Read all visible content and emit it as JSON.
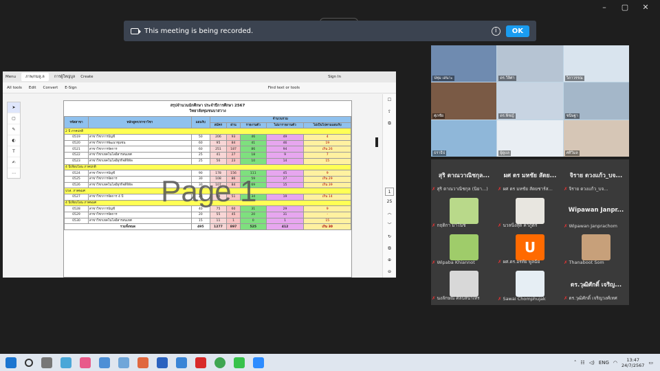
{
  "window": {
    "min": "–",
    "max": "▢",
    "close": "✕"
  },
  "recbar": {
    "message": "This meeting is being recorded.",
    "ok": "OK",
    "info": "i"
  },
  "pdf": {
    "tabs": [
      "Menu",
      "ภาพ/กมลู.ล",
      "การผู้ใหญ่บูล",
      "Create",
      "Sign In"
    ],
    "menu": [
      "All tools",
      "Edit",
      "Convert",
      "E-Sign"
    ],
    "find": "Find text or tools",
    "title": "สรุปจำนวนนักศึกษา ประจำปีการศึกษา 2567",
    "subtitle": "วิทยาลัยชุมชนบาสวาง",
    "watermark": "Page 1",
    "headers": [
      "รหัสสาขา",
      "หลักสูตร/สาขาวิชา",
      "แผนรับ",
      "สมัคร",
      "ผ่าน",
      "รายงานตัว",
      "ไม่มารายงานตัว",
      "ไม่เป็นไปตามแผนรับ"
    ],
    "group_header": "จำนวนรวม",
    "page_num": "1",
    "page_total": "25",
    "rows": [
      {
        "sec": "2 ปี ภาคปกติ"
      },
      {
        "c": "0519",
        "n": "สาขาวิชาการบัญชี",
        "p": "50",
        "a": "206",
        "b": "93",
        "r": "46",
        "x": "49",
        "d": "4"
      },
      {
        "c": "0520",
        "n": "สาขาวิชาการพัฒนาชุมชน",
        "p": "60",
        "a": "95",
        "b": "84",
        "r": "41",
        "x": "46",
        "d": "19"
      },
      {
        "c": "0521",
        "n": "สาขาวิชาการจัดการ",
        "p": "60",
        "a": "251",
        "b": "187",
        "r": "86",
        "x": "94",
        "d": "เกิน 26"
      },
      {
        "c": "0522",
        "n": "สาขาวิชาเทคโนโลยีสารสนเทศ",
        "p": "25",
        "a": "41",
        "b": "27",
        "r": "18",
        "x": "9",
        "d": "7"
      },
      {
        "c": "0523",
        "n": "สาขาวิชาเทคโนโลยีธุรกิจดิจิทัล",
        "p": "25",
        "a": "56",
        "b": "23",
        "r": "10",
        "x": "14",
        "d": "15"
      },
      {
        "sec": "4 ปีเทียบโอน ภาคปกติ"
      },
      {
        "c": "0524",
        "n": "สาขาวิชาการบัญชี",
        "p": "90",
        "a": "178",
        "b": "156",
        "r": "111",
        "x": "45",
        "d": "9"
      },
      {
        "c": "0525",
        "n": "สาขาวิชาการจัดการ",
        "p": "30",
        "a": "108",
        "b": "86",
        "r": "59",
        "x": "27",
        "d": "เกิน 29"
      },
      {
        "c": "0526",
        "n": "สาขาวิชาเทคโนโลยีธุรกิจดิจิทัล",
        "p": "30",
        "a": "107",
        "b": "84",
        "r": "69",
        "x": "15",
        "d": "เกิน 39"
      },
      {
        "sec": "ปวส. ภาคพมศ"
      },
      {
        "c": "0527",
        "n": "สาขาวิชาการจัดการ 4 ปี",
        "p": "20",
        "a": "94",
        "b": "51",
        "r": "34",
        "x": "19",
        "d": "เกิน 14"
      },
      {
        "sec": "4 ปีเทียบโอน ภาคพมศ"
      },
      {
        "c": "0528",
        "n": "สาขาวิชาการบัญชี",
        "p": "40",
        "a": "75",
        "b": "60",
        "r": "31",
        "x": "29",
        "d": "9"
      },
      {
        "c": "0529",
        "n": "สาขาวิชาการจัดการ",
        "p": "20",
        "a": "55",
        "b": "45",
        "r": "20",
        "x": "31",
        "d": "-"
      },
      {
        "c": "0530",
        "n": "สาขาวิชาเทคโนโลยีสารสนเทศ",
        "p": "15",
        "a": "11",
        "b": "1",
        "r": "0",
        "x": "1",
        "d": "15"
      }
    ],
    "total": {
      "label": "รวมทั้งหมด",
      "p": "495",
      "a": "1277",
      "b": "897",
      "r": "525",
      "x": "412",
      "d": "เกิน 30"
    }
  },
  "videos": [
    "ปทุม เสนาะ",
    "ดร.วิลิศา",
    "วิภาวรรณ",
    "ศุภชัย",
    "ดร.พิชญ์",
    "ชนิษฐา",
    "ธราธิป",
    "ผู้ดูแล",
    "ศศิวิมล"
  ],
  "participants": [
    {
      "big": "สุริ ตาณวาณิชกุล...",
      "label": "สุริ ตาณวาณิชกุล (นิยา...)",
      "kind": "name"
    },
    {
      "big": "ผศ ดร มหชัย สัตย...",
      "label": "ผศ ดร มหชัย สัตยชาร์ส...",
      "kind": "name"
    },
    {
      "big": "จิราย ดวงแก้ว_บจ...",
      "label": "จิราย ดวงแก้ว_บจ...",
      "kind": "name"
    },
    {
      "big": "",
      "label": "กฤติกา มาโนช",
      "kind": "photo",
      "color": "#b9d98a"
    },
    {
      "big": "",
      "label": "นวลนิ่งสุด คำภูตริ",
      "kind": "photo",
      "color": "#e8e6e0"
    },
    {
      "big": "Wipawan Janpr...",
      "label": "Wipawan Janprachom",
      "kind": "name"
    },
    {
      "big": "",
      "label": "Wipaba Khiannot",
      "kind": "photo",
      "color": "#9fcc6a"
    },
    {
      "big": "U",
      "label": "ผศ.ดร.อรทัย พูลฉัย",
      "kind": "letter",
      "color": "#ff6a00"
    },
    {
      "big": "",
      "label": "Thanaboot Som",
      "kind": "photo",
      "color": "#c7a07a"
    },
    {
      "big": "",
      "label": "นงลักษณ์ ศิลปสนาเทร",
      "kind": "photo",
      "color": "#d8d8d8"
    },
    {
      "big": "",
      "label": "Sawai Chomphujak",
      "kind": "photo",
      "color": "#e6eef4"
    },
    {
      "big": "ดร.วุฒิศักดิ์ เจริญ...",
      "label": "ดร.วุฒิศักดิ์ เจริญวงศ์เทศ",
      "kind": "name"
    }
  ],
  "tray": {
    "lang": "ENG",
    "time": "13:47",
    "date": "24/7/2567"
  }
}
